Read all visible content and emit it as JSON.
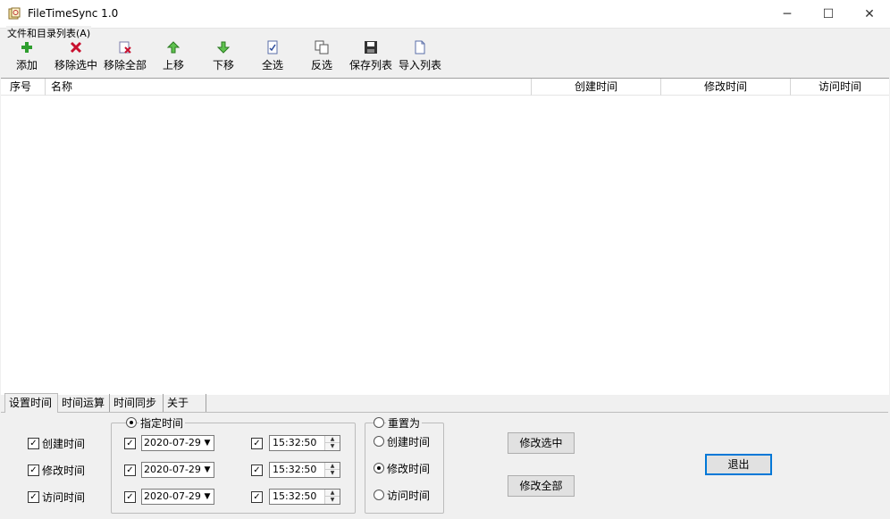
{
  "window": {
    "title": "FileTimeSync 1.0",
    "min_icon": "─",
    "max_icon": "☐",
    "close_icon": "✕"
  },
  "toolbar": {
    "group_label": "文件和目录列表(A)",
    "buttons": [
      {
        "label": "添加",
        "icon": "plus-icon"
      },
      {
        "label": "移除选中",
        "icon": "x-icon"
      },
      {
        "label": "移除全部",
        "icon": "remove-all-icon"
      },
      {
        "label": "上移",
        "icon": "arrow-up-icon"
      },
      {
        "label": "下移",
        "icon": "arrow-down-icon"
      },
      {
        "label": "全选",
        "icon": "select-all-icon"
      },
      {
        "label": "反选",
        "icon": "invert-select-icon"
      },
      {
        "label": "保存列表",
        "icon": "save-icon"
      },
      {
        "label": "导入列表",
        "icon": "import-icon"
      }
    ]
  },
  "list": {
    "columns": [
      "序号",
      "名称",
      "创建时间",
      "修改时间",
      "访问时间"
    ],
    "rows": []
  },
  "tabs": [
    "设置时间",
    "时间运算",
    "时间同步",
    "关于"
  ],
  "settings": {
    "checks": [
      "创建时间",
      "修改时间",
      "访问时间"
    ],
    "specified_label": "指定时间",
    "dates": [
      "2020-07-29",
      "2020-07-29",
      "2020-07-29"
    ],
    "times": [
      "15:32:50",
      "15:32:50",
      "15:32:50"
    ],
    "reset_label": "重置为",
    "reset_options": [
      "创建时间",
      "修改时间",
      "访问时间"
    ],
    "reset_selected": "修改时间",
    "btn_modify_selected": "修改选中",
    "btn_modify_all": "修改全部",
    "btn_exit": "退出"
  },
  "colors": {
    "accent": "#0078d7",
    "add_green": "#2e9e2e",
    "remove_red": "#c8102e"
  }
}
